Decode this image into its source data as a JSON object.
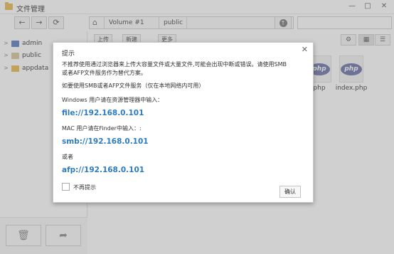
{
  "window": {
    "title": "文件管理",
    "min_glyph": "—",
    "max_glyph": "□",
    "close_glyph": "✕"
  },
  "toolbar": {
    "back_glyph": "←",
    "forward_glyph": "→",
    "refresh_glyph": "⟳",
    "home_glyph": "⌂",
    "breadcrumb": [
      "Volume #1",
      "public"
    ],
    "up_glyph": "↑"
  },
  "sidebar": {
    "items": [
      {
        "label": "admin",
        "icon": "user-folder-icon"
      },
      {
        "label": "public",
        "icon": "public-folder-icon"
      },
      {
        "label": "appdata",
        "icon": "folder-icon"
      }
    ],
    "delete_glyph": "🗑",
    "share_glyph": "➦"
  },
  "main_toolbar": {
    "upload_label": "上传",
    "new_label": "新建",
    "more_label": "更多",
    "settings_glyph": "⚙",
    "grid_glyph": "▦",
    "list_glyph": "☰"
  },
  "files": [
    {
      "name": "php",
      "icon": "php-file-icon"
    },
    {
      "name": "index.php",
      "icon": "php-file-icon"
    }
  ],
  "file_icon_text": "php",
  "dialog": {
    "title": "提示",
    "close_glyph": "✕",
    "warning_line1": "不推荐使用通过浏览器来上传大容量文件或大量文件,可能会出现中断或错误。请使用SMB",
    "warning_line2": "或者AFP文件服务作为替代方案。",
    "use_hint": "如要使用SMB或者AFP文件服务（仅在本地网络内可用）",
    "windows_hint": "Windows 用户请在资源管理器中输入：",
    "windows_address": "file://192.168.0.101",
    "mac_hint": "MAC 用户请在Finder中输入：:",
    "mac_smb_address": "smb://192.168.0.101",
    "or_label": "或者",
    "mac_afp_address": "afp://192.168.0.101",
    "no_remind_label": "不再提示",
    "confirm_label": "确认"
  }
}
